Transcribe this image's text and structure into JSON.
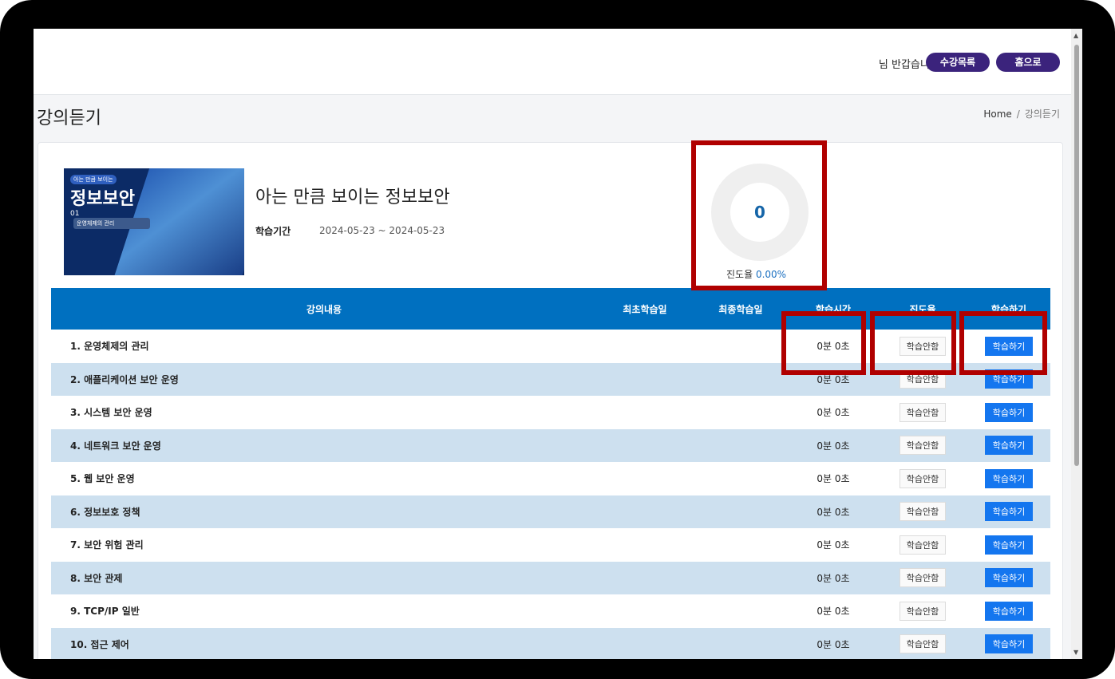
{
  "header": {
    "greeting": "님 반갑습니다!",
    "courses_button": "수강목록",
    "home_button": "홈으로"
  },
  "page": {
    "title": "강의듣기",
    "breadcrumb_home": "Home",
    "breadcrumb_sep": "/",
    "breadcrumb_current": "강의듣기"
  },
  "course": {
    "thumb_tag": "아는 만큼 보이는",
    "thumb_title": "정보보안",
    "thumb_num": "01",
    "thumb_subtitle": "운영체제의 관리",
    "name": "아는 만큼 보이는 정보보안",
    "period_label": "학습기간",
    "period_value": "2024-05-23 ~ 2024-05-23"
  },
  "progress": {
    "center_value": "0",
    "label": "진도율",
    "percent_text": "0.00%",
    "percent_value": 0.0
  },
  "table": {
    "headers": [
      "강의내용",
      "최초학습일",
      "최종학습일",
      "학습시간",
      "진도율",
      "학습하기"
    ],
    "rows": [
      {
        "title": "1. 운영체제의 관리",
        "first": "",
        "last": "",
        "time": "0분 0초",
        "status": "학습안함",
        "action": "학습하기"
      },
      {
        "title": "2. 애플리케이션 보안 운영",
        "first": "",
        "last": "",
        "time": "0분 0초",
        "status": "학습안함",
        "action": "학습하기"
      },
      {
        "title": "3. 시스템 보안 운영",
        "first": "",
        "last": "",
        "time": "0분 0초",
        "status": "학습안함",
        "action": "학습하기"
      },
      {
        "title": "4. 네트워크 보안 운영",
        "first": "",
        "last": "",
        "time": "0분 0초",
        "status": "학습안함",
        "action": "학습하기"
      },
      {
        "title": "5. 웹 보안 운영",
        "first": "",
        "last": "",
        "time": "0분 0초",
        "status": "학습안함",
        "action": "학습하기"
      },
      {
        "title": "6. 정보보호 정책",
        "first": "",
        "last": "",
        "time": "0분 0초",
        "status": "학습안함",
        "action": "학습하기"
      },
      {
        "title": "7. 보안 위험 관리",
        "first": "",
        "last": "",
        "time": "0분 0초",
        "status": "학습안함",
        "action": "학습하기"
      },
      {
        "title": "8. 보안 관제",
        "first": "",
        "last": "",
        "time": "0분 0초",
        "status": "학습안함",
        "action": "학습하기"
      },
      {
        "title": "9. TCP/IP 일반",
        "first": "",
        "last": "",
        "time": "0분 0초",
        "status": "학습안함",
        "action": "학습하기"
      },
      {
        "title": "10. 접근 제어",
        "first": "",
        "last": "",
        "time": "0분 0초",
        "status": "학습안함",
        "action": "학습하기"
      }
    ]
  },
  "colors": {
    "header_bg": "#0070c0",
    "row_alt": "#cde0ef",
    "study_button": "#1476ef",
    "pill_button": "#3b237c",
    "highlight": "#b00000"
  }
}
